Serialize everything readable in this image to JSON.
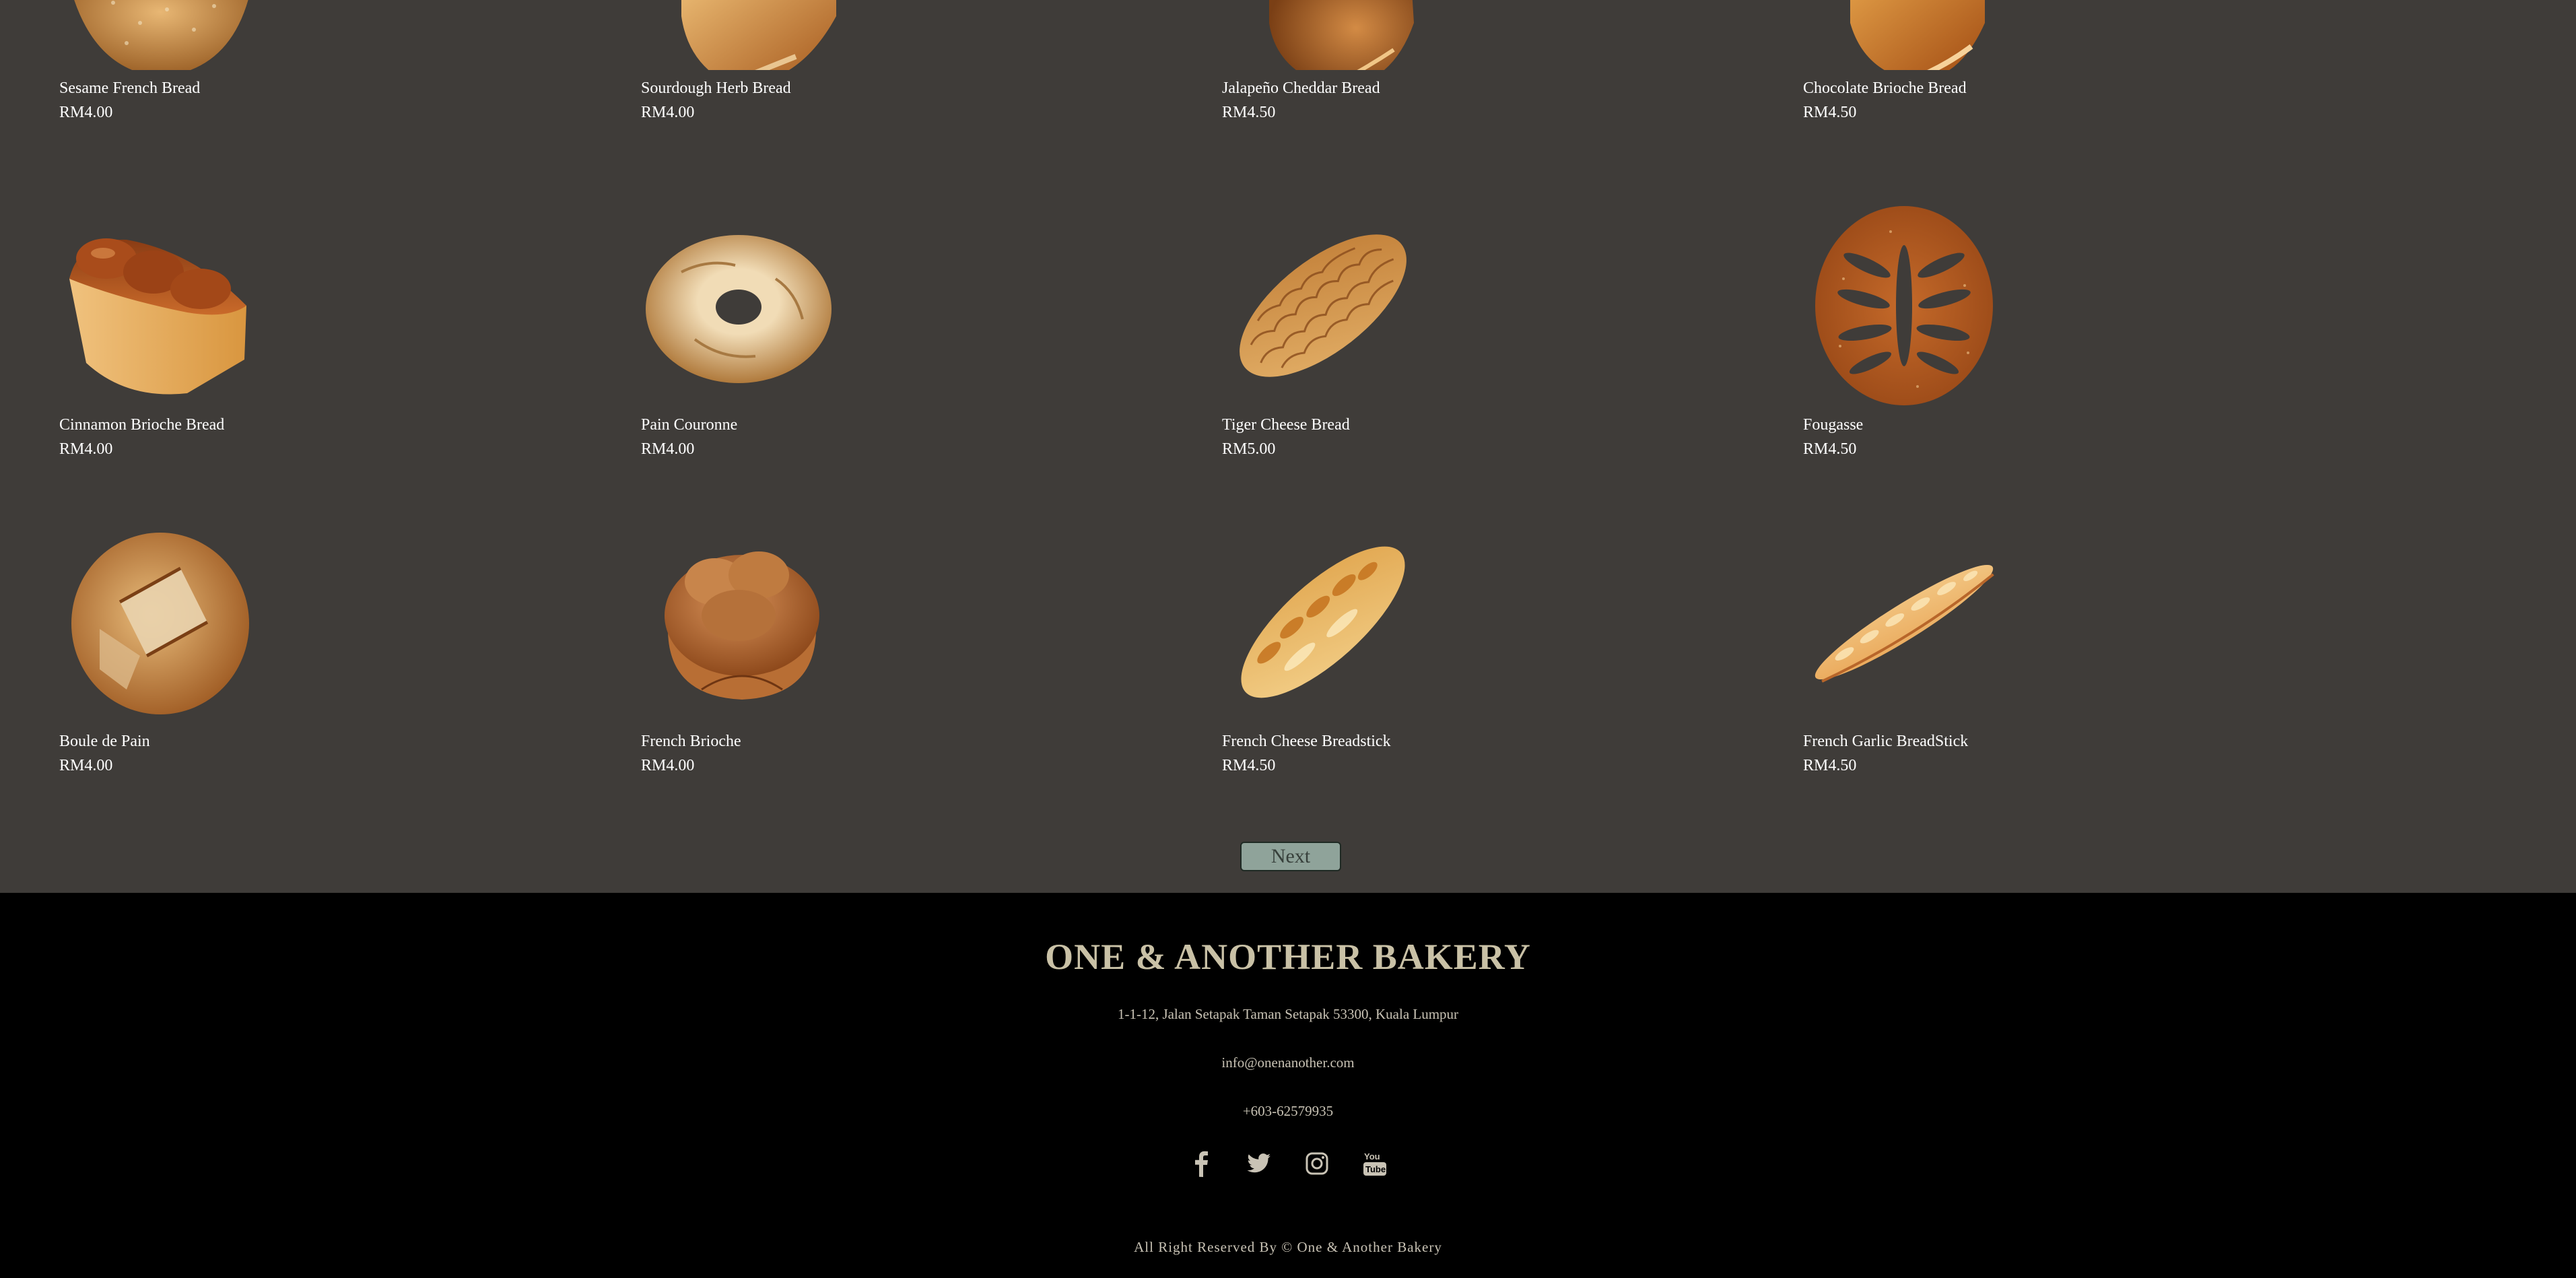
{
  "products": [
    {
      "name": "Sesame French Bread",
      "price": "RM4.00",
      "icon": "sesame-french-bread-image"
    },
    {
      "name": "Sourdough Herb Bread",
      "price": "RM4.00",
      "icon": "sourdough-herb-bread-image"
    },
    {
      "name": "Jalapeño Cheddar Bread",
      "price": "RM4.50",
      "icon": "jalapeno-cheddar-bread-image"
    },
    {
      "name": "Chocolate Brioche Bread",
      "price": "RM4.50",
      "icon": "chocolate-brioche-bread-image"
    },
    {
      "name": "Cinnamon Brioche Bread",
      "price": "RM4.00",
      "icon": "cinnamon-brioche-bread-image"
    },
    {
      "name": "Pain Couronne",
      "price": "RM4.00",
      "icon": "pain-couronne-image"
    },
    {
      "name": "Tiger Cheese Bread",
      "price": "RM5.00",
      "icon": "tiger-cheese-bread-image"
    },
    {
      "name": "Fougasse",
      "price": "RM4.50",
      "icon": "fougasse-image"
    },
    {
      "name": "Boule de Pain",
      "price": "RM4.00",
      "icon": "boule-de-pain-image"
    },
    {
      "name": "French Brioche",
      "price": "RM4.00",
      "icon": "french-brioche-image"
    },
    {
      "name": "French Cheese Breadstick",
      "price": "RM4.50",
      "icon": "french-cheese-breadstick-image"
    },
    {
      "name": "French Garlic BreadStick",
      "price": "RM4.50",
      "icon": "french-garlic-breadstick-image"
    }
  ],
  "pagination": {
    "next_label": "Next"
  },
  "footer": {
    "brand": "ONE & ANOTHER BAKERY",
    "address": "1-1-12, Jalan Setapak Taman Setapak 53300, Kuala Lumpur",
    "email": "info@onenanother.com",
    "phone": "+603-62579935",
    "socials": [
      "facebook-icon",
      "twitter-icon",
      "instagram-icon",
      "youtube-icon"
    ],
    "copyright": "All Right Reserved By © One & Another Bakery"
  },
  "colors": {
    "page_bg": "#3f3c39",
    "footer_bg": "#000000",
    "brand_text": "#c9c1a6",
    "button_bg": "#8fa39a"
  }
}
